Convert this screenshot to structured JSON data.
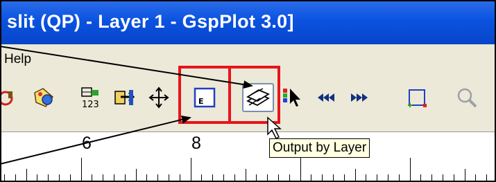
{
  "window": {
    "title": "slit (QP) - Layer 1 - GspPlot 3.0]"
  },
  "menu": {
    "help": "Help"
  },
  "toolbar": {
    "buttons": [
      {
        "name": "red-circle-tool-icon"
      },
      {
        "name": "palette-tool-icon"
      },
      {
        "name": "number-format-icon"
      },
      {
        "name": "export-icon"
      },
      {
        "name": "move-crosshair-icon"
      },
      {
        "name": "e-box-icon"
      },
      {
        "name": "output-by-layer-icon"
      },
      {
        "name": "color-pointer-icon"
      },
      {
        "name": "rewind-icon"
      },
      {
        "name": "fast-forward-icon"
      },
      {
        "name": "bounding-box-icon"
      },
      {
        "name": "zoom-icon"
      }
    ]
  },
  "ruler": {
    "labels": [
      "6",
      "8"
    ]
  },
  "tooltip": {
    "text": "Output by Layer"
  },
  "highlight_color": "#e8141c"
}
